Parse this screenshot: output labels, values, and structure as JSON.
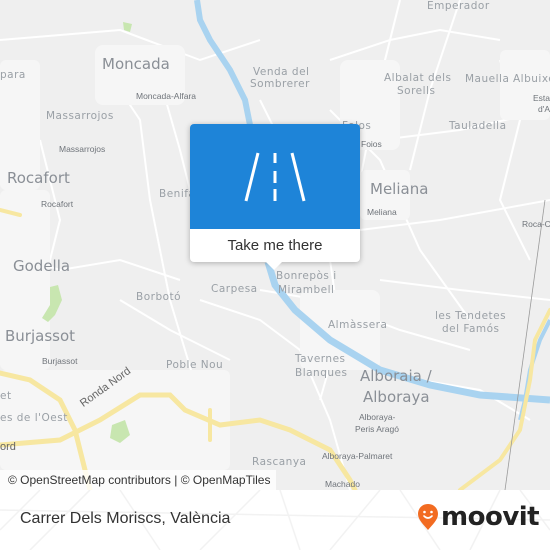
{
  "map": {
    "colors": {
      "land": "#efefef",
      "road": "#ffffff",
      "highway": "#f7e7a1",
      "water": "#a9d3f0",
      "park": "#c8e6b0",
      "label": "#8a8f96"
    },
    "labels": {
      "cities": [
        "Moncada",
        "Rocafort",
        "Godella",
        "Burjassot",
        "Meliana",
        "Alboraia /",
        "Alboraya"
      ],
      "towns": [
        "Emperador",
        "Venda del",
        "Sombrerer",
        "Albalat dels",
        "Sorells",
        "Mauella",
        "Albuixe",
        "Massarrojos",
        "Benifa",
        "Tauladella",
        "Folos",
        "Borbotó",
        "Carpesa",
        "Poble Nou",
        "Almàssera",
        "les Tendetes",
        "del Famós",
        "Tavernes",
        "Blanques",
        "Bonrepòs i",
        "Mirambell",
        "para",
        "es de l'Oest",
        "et",
        "Rascanya"
      ],
      "stops": [
        "Moncada-Alfara",
        "Massarrojos",
        "Rocafort",
        "Foios",
        "Meliana",
        "Roca-C",
        "Esta",
        "d'A",
        "Burjassot",
        "Alboraya-",
        "Peris Aragó",
        "Alboraya-Palmaret",
        "Machado"
      ],
      "roads": [
        "Ronda Nord",
        "ord"
      ]
    },
    "attribution": {
      "osm": "© OpenStreetMap contributors",
      "separator": " | ",
      "omt": "© OpenMapTiles"
    }
  },
  "popup": {
    "icon": "road-icon",
    "cta_label": "Take me there",
    "hero_color": "#1e84d8"
  },
  "footer": {
    "title": "Carrer Dels Moriscs, València",
    "brand": "moovit",
    "brand_color": "#f26b21"
  }
}
